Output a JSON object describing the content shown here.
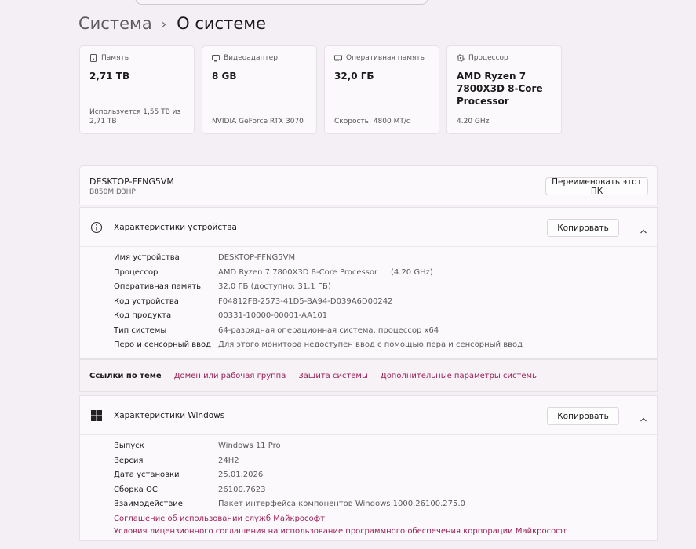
{
  "breadcrumb": {
    "parent": "Система",
    "separator": "›",
    "current": "О системе"
  },
  "cards": [
    {
      "icon": "storage-icon",
      "label": "Память",
      "value": "2,71 ТВ",
      "sub": "Используется 1,55 ТВ из 2,71 ТВ"
    },
    {
      "icon": "gpu-icon",
      "label": "Видеоадаптер",
      "value": "8 GB",
      "sub": "NVIDIA GeForce RTX 3070"
    },
    {
      "icon": "ram-icon",
      "label": "Оперативная память",
      "value": "32,0 ГБ",
      "sub": "Скорость: 4800 MT/с"
    },
    {
      "icon": "processor-icon",
      "label": "Процессор",
      "value": "AMD Ryzen 7 7800X3D 8-Core Processor",
      "sub": "4.20 GHz"
    }
  ],
  "pc": {
    "name": "DESKTOP-FFNG5VM",
    "model": "B850M D3HP",
    "rename_label": "Переименовать этот ПК"
  },
  "device_specs": {
    "title": "Характеристики устройства",
    "copy_label": "Копировать",
    "rows": [
      {
        "key": "Имя устройства",
        "value": "DESKTOP-FFNG5VM"
      },
      {
        "key": "Процессор",
        "value": "AMD Ryzen 7 7800X3D 8-Core Processor",
        "extra": "(4.20 GHz)"
      },
      {
        "key": "Оперативная память",
        "value": "32,0 ГБ (доступно: 31,1 ГБ)"
      },
      {
        "key": "Код устройства",
        "value": "F04812FB-2573-41D5-BA94-D039A6D00242"
      },
      {
        "key": "Код продукта",
        "value": "00331-10000-00001-AA101"
      },
      {
        "key": "Тип системы",
        "value": "64-разрядная операционная система, процессор x64"
      },
      {
        "key": "Перо и сенсорный ввод",
        "value": "Для этого монитора недоступен ввод с помощью пера и сенсорный ввод"
      }
    ]
  },
  "related": {
    "title": "Ссылки по теме",
    "links": [
      "Домен или рабочая группа",
      "Защита системы",
      "Дополнительные параметры системы"
    ]
  },
  "windows_specs": {
    "title": "Характеристики Windows",
    "copy_label": "Копировать",
    "rows": [
      {
        "key": "Выпуск",
        "value": "Windows 11 Pro"
      },
      {
        "key": "Версия",
        "value": "24H2"
      },
      {
        "key": "Дата установки",
        "value": "25.01.2026"
      },
      {
        "key": "Сборка ОС",
        "value": "26100.7623"
      },
      {
        "key": "Взаимодействие",
        "value": "Пакет интерфейса компонентов Windows 1000.26100.275.0"
      }
    ],
    "links": [
      "Соглашение об использовании служб Майкрософт",
      "Условия лицензионного соглашения на использование программного обеспечения корпорации Майкрософт"
    ]
  },
  "colors": {
    "accent_link": "#9b1f58",
    "background": "#f4eff4",
    "card": "#fbf9fb"
  }
}
